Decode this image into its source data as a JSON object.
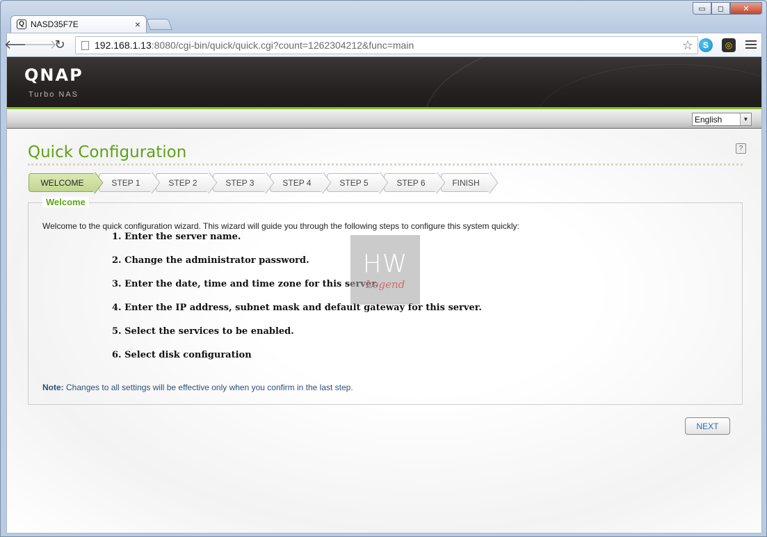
{
  "browser": {
    "tab_title": "NASD35F7E",
    "tab_close": "×",
    "url_host": "192.168.1.13",
    "url_rest": ":8080/cgi-bin/quick/quick.cgi?count=1262304212&func=main",
    "window_controls": {
      "minimize": "▭",
      "maximize": "◻",
      "close": "✕"
    }
  },
  "header": {
    "logo": "QNAP",
    "logo_sub": "Turbo NAS",
    "language": "English"
  },
  "page": {
    "title": "Quick Configuration",
    "help": "?"
  },
  "steps": [
    "WELCOME",
    "STEP 1",
    "STEP 2",
    "STEP 3",
    "STEP 4",
    "STEP 5",
    "STEP 6",
    "FINISH"
  ],
  "welcome": {
    "legend": "Welcome",
    "intro": "Welcome to the quick configuration wizard. This wizard will guide you through the following steps to configure this system quickly:",
    "items": [
      "1. Enter the server name.",
      "2. Change the administrator password.",
      "3. Enter the date, time and time zone for this server.",
      "4. Enter the IP address, subnet mask and default gateway for this server.",
      "5. Select the services to be enabled.",
      "6. Select disk configuration"
    ],
    "note_label": "Note:",
    "note_text": " Changes to all settings will be effective only when you confirm in the last step."
  },
  "watermark": {
    "big": "HW",
    "small": "Legend"
  },
  "actions": {
    "next": "NEXT"
  },
  "colors": {
    "accent_green": "#5ea218",
    "note_blue": "#2a4f7a",
    "link_blue": "#2a6fb5"
  }
}
